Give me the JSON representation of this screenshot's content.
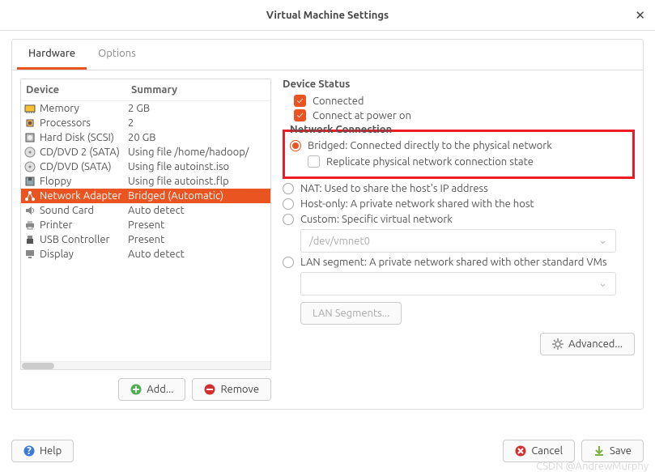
{
  "window": {
    "title": "Virtual Machine Settings"
  },
  "tabs": {
    "hardware": "Hardware",
    "options": "Options"
  },
  "device_table": {
    "head_device": "Device",
    "head_summary": "Summary",
    "rows": [
      {
        "icon": "memory",
        "name": "Memory",
        "summary": "2 GB"
      },
      {
        "icon": "cpu",
        "name": "Processors",
        "summary": "2"
      },
      {
        "icon": "disk",
        "name": "Hard Disk (SCSI)",
        "summary": "20 GB"
      },
      {
        "icon": "cd",
        "name": "CD/DVD 2 (SATA)",
        "summary": "Using file /home/hadoop/"
      },
      {
        "icon": "cd",
        "name": "CD/DVD (SATA)",
        "summary": "Using file autoinst.iso"
      },
      {
        "icon": "floppy",
        "name": "Floppy",
        "summary": "Using file autoinst.flp"
      },
      {
        "icon": "net",
        "name": "Network Adapter",
        "summary": "Bridged (Automatic)",
        "selected": true
      },
      {
        "icon": "sound",
        "name": "Sound Card",
        "summary": "Auto detect"
      },
      {
        "icon": "printer",
        "name": "Printer",
        "summary": "Present"
      },
      {
        "icon": "usb",
        "name": "USB Controller",
        "summary": "Present"
      },
      {
        "icon": "display",
        "name": "Display",
        "summary": "Auto detect"
      }
    ]
  },
  "buttons": {
    "add": "Add...",
    "remove": "Remove",
    "advanced": "Advanced...",
    "help": "Help",
    "cancel": "Cancel",
    "save": "Save",
    "lan_segments": "LAN Segments..."
  },
  "device_status": {
    "title": "Device Status",
    "connected": "Connected",
    "connect_power": "Connect at power on"
  },
  "network": {
    "title": "Network Connection",
    "bridged": "Bridged: Connected directly to the physical network",
    "replicate": "Replicate physical network connection state",
    "nat": "NAT: Used to share the host's IP address",
    "hostonly": "Host-only: A private network shared with the host",
    "custom": "Custom: Specific virtual network",
    "custom_value": "/dev/vmnet0",
    "lan": "LAN segment: A private network shared with other standard VMs",
    "lan_value": ""
  },
  "watermark": "CSDN @AndrewMurphy"
}
